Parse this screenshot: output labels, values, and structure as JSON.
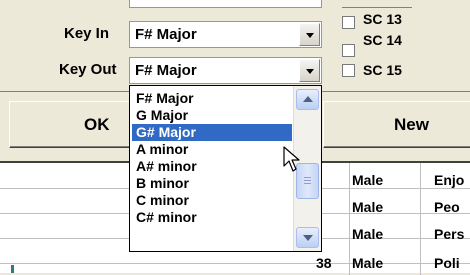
{
  "form": {
    "key_in_label": "Key In",
    "key_in_value": "F# Major",
    "key_out_label": "Key Out",
    "key_out_value": "F# Major"
  },
  "checkboxes": [
    {
      "label": "SC 13",
      "checked": false
    },
    {
      "label": "SC 14",
      "checked": false
    },
    {
      "label": "SC 15",
      "checked": false
    }
  ],
  "buttons": {
    "ok": "OK",
    "new": "New"
  },
  "dropdown": {
    "options": [
      "F# Major",
      "G Major",
      "G# Major",
      "A minor",
      "A# minor",
      "B minor",
      "C minor",
      "C# minor"
    ],
    "selected": "G# Major",
    "highlight_color": "#316ac5"
  },
  "grid": {
    "rows": [
      {
        "number": "",
        "gender": "Male",
        "description": "Enjo"
      },
      {
        "number": "",
        "gender": "Male",
        "description": "Peo"
      },
      {
        "number": "",
        "gender": "Male",
        "description": "Pers"
      },
      {
        "number": "38",
        "gender": "Male",
        "description": "Poli"
      }
    ]
  },
  "colors": {
    "dialog_bg": "#ece9d8",
    "field_border": "#7f9db9"
  }
}
